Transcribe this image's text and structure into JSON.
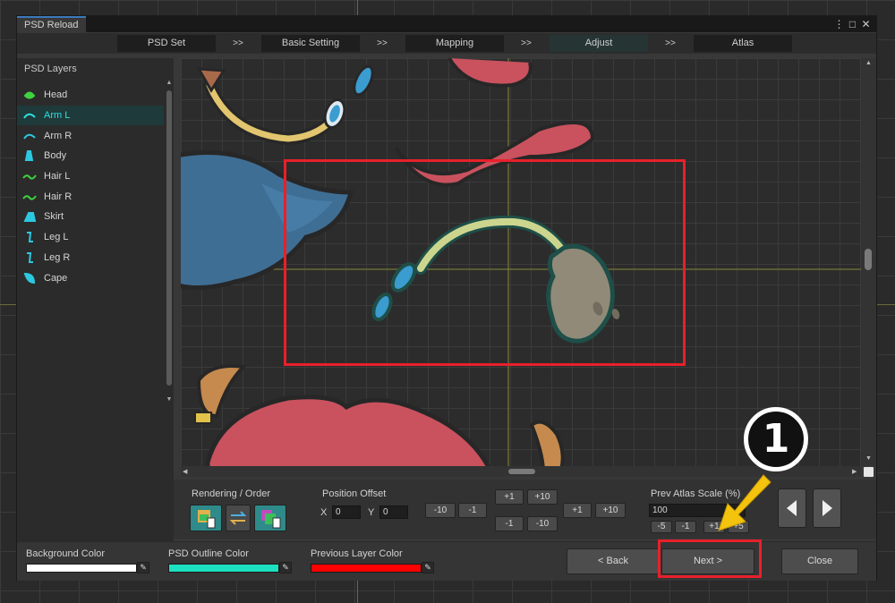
{
  "window": {
    "tab_title": "PSD Reload",
    "controls": [
      "⋮",
      "□",
      "✕"
    ]
  },
  "steps": [
    {
      "label": "PSD Set"
    },
    {
      "label": "Basic Setting"
    },
    {
      "label": "Mapping"
    },
    {
      "label": "Adjust",
      "active": true
    },
    {
      "label": "Atlas"
    }
  ],
  "step_separator": ">>",
  "sidebar": {
    "title": "PSD Layers",
    "layers": [
      {
        "label": "Head",
        "icon": "head-layer-icon",
        "color": "#3fd23f"
      },
      {
        "label": "Arm L",
        "icon": "arm-layer-icon",
        "color": "#2ce0e0",
        "selected": true
      },
      {
        "label": "Arm R",
        "icon": "arm-layer-icon",
        "color": "#2cc8e0"
      },
      {
        "label": "Body",
        "icon": "body-layer-icon",
        "color": "#2cc8e0"
      },
      {
        "label": "Hair L",
        "icon": "hair-layer-icon",
        "color": "#3fd23f"
      },
      {
        "label": "Hair R",
        "icon": "hair-layer-icon",
        "color": "#3fd23f"
      },
      {
        "label": "Skirt",
        "icon": "skirt-layer-icon",
        "color": "#2cc8e0"
      },
      {
        "label": "Leg L",
        "icon": "leg-layer-icon",
        "color": "#2cc8e0"
      },
      {
        "label": "Leg R",
        "icon": "leg-layer-icon",
        "color": "#2cc8e0"
      },
      {
        "label": "Cape",
        "icon": "cape-layer-icon",
        "color": "#2cc8e0"
      }
    ]
  },
  "controls": {
    "rendering_label": "Rendering / Order",
    "position_label": "Position Offset",
    "x_label": "X",
    "x_value": "0",
    "y_label": "Y",
    "y_value": "0",
    "nudge": {
      "left_minus10": "-10",
      "left_minus1": "-1",
      "up_plus1": "+1",
      "up_plus10": "+10",
      "down_minus1": "-1",
      "down_minus10": "-10",
      "right_plus1": "+1",
      "right_plus10": "+10"
    },
    "scale_label": "Prev Atlas Scale (%)",
    "scale_value": "100",
    "scale_minus5": "-5",
    "scale_minus1": "-1",
    "scale_plus1": "+1",
    "scale_plus5": "+5"
  },
  "bottom": {
    "background_color_label": "Background Color",
    "background_color": "#ffffff",
    "outline_color_label": "PSD Outline Color",
    "outline_color": "#1de0c0",
    "previous_layer_color_label": "Previous Layer Color",
    "previous_layer_color": "#ff0000",
    "back_label": "< Back",
    "next_label": "Next >",
    "close_label": "Close"
  },
  "annotation": {
    "step_number": "1"
  }
}
